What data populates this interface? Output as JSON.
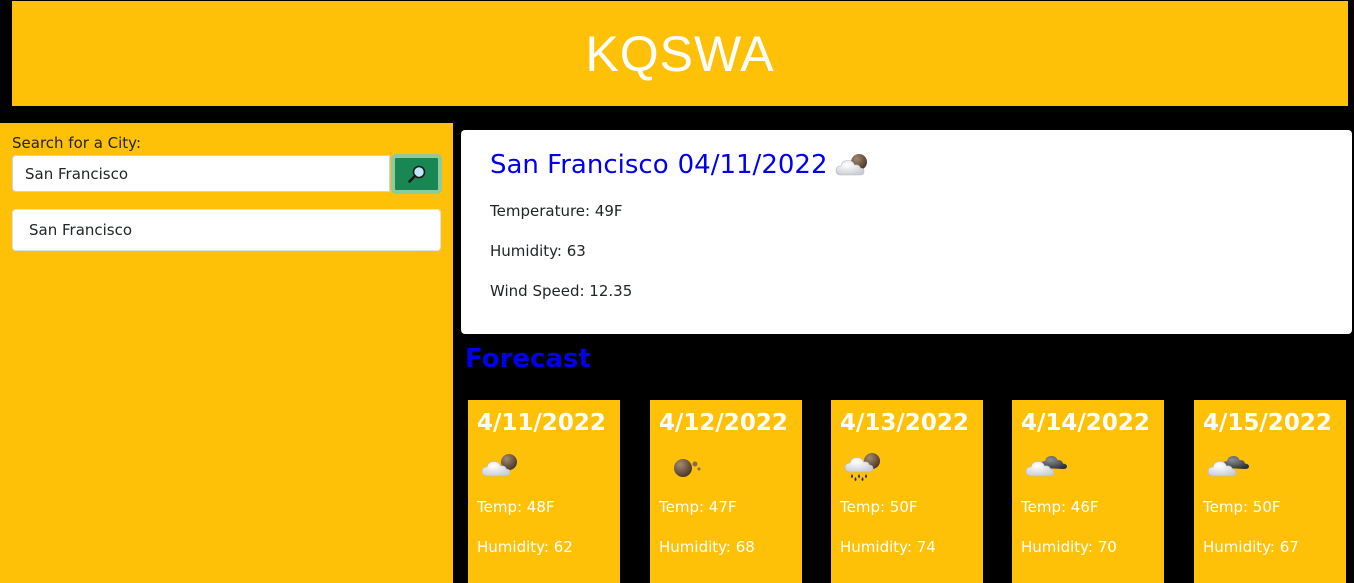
{
  "app": {
    "title": "KQSWA"
  },
  "search": {
    "label": "Search for a City:",
    "value": "San Francisco",
    "placeholder": "",
    "button_icon": "search-icon"
  },
  "history": [
    {
      "label": "San Francisco"
    }
  ],
  "current": {
    "city": "San Francisco",
    "date": "04/11/2022",
    "icon": "partly-cloudy-icon",
    "temperature": "Temperature: 49F",
    "humidity": "Humidity: 63",
    "wind": "Wind Speed: 12.35"
  },
  "forecast": {
    "heading": "Forecast",
    "days": [
      {
        "date": "4/11/2022",
        "icon": "partly-cloudy-icon",
        "temp": "Temp: 48F",
        "humidity": "Humidity: 62"
      },
      {
        "date": "4/12/2022",
        "icon": "overcast-icon",
        "temp": "Temp: 47F",
        "humidity": "Humidity: 68"
      },
      {
        "date": "4/13/2022",
        "icon": "rain-icon",
        "temp": "Temp: 50F",
        "humidity": "Humidity: 74"
      },
      {
        "date": "4/14/2022",
        "icon": "broken-clouds-icon",
        "temp": "Temp: 46F",
        "humidity": "Humidity: 70"
      },
      {
        "date": "4/15/2022",
        "icon": "broken-clouds-icon",
        "temp": "Temp: 50F",
        "humidity": "Humidity: 67"
      }
    ]
  },
  "colors": {
    "accent": "#ffc107",
    "background": "#000000",
    "link_blue": "#0000ee",
    "button_green": "#198754"
  }
}
